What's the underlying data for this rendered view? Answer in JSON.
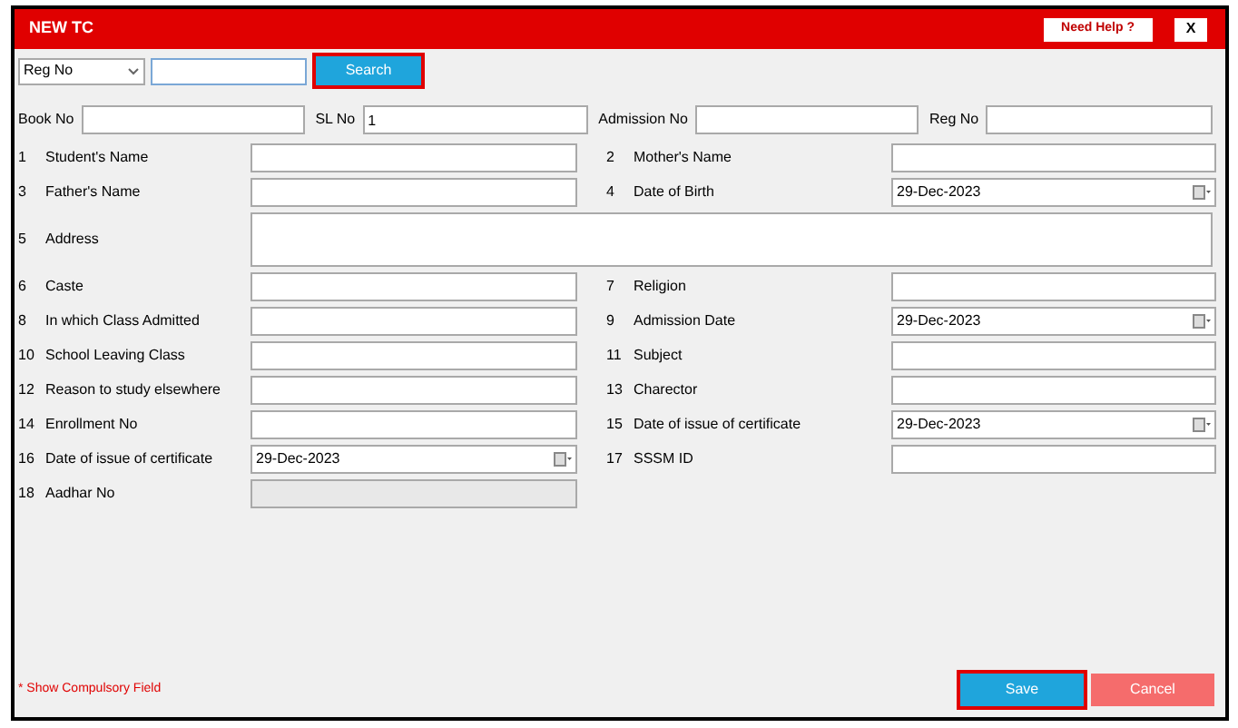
{
  "window": {
    "title": "NEW TC",
    "help_button": "Need Help ?",
    "close_button": "X"
  },
  "search_bar": {
    "select": "Reg No",
    "button": {
      "label": "Search",
      "highlighted": true
    }
  },
  "top_fields": [
    {
      "label": "Book No"
    },
    {
      "label": "SL No",
      "value": "1"
    },
    {
      "label": "Admission No"
    },
    {
      "label": "Reg No"
    }
  ],
  "rows": [
    {
      "fields": [
        {
          "number": "1",
          "label": "Student's Name",
          "kind": "text",
          "disabled": false
        },
        {
          "number": "2",
          "label": "Mother's Name",
          "kind": "text",
          "disabled": false
        }
      ]
    },
    {
      "fields": [
        {
          "number": "3",
          "label": "Father's Name",
          "kind": "text",
          "disabled": false
        },
        {
          "number": "4",
          "label": "Date of Birth",
          "kind": "date",
          "value": "29-Dec-2023"
        }
      ]
    },
    {
      "fields": [
        {
          "number": "5",
          "label": "Address",
          "kind": "area"
        }
      ]
    },
    {
      "fields": [
        {
          "number": "6",
          "label": "Caste",
          "kind": "text",
          "disabled": false
        },
        {
          "number": "7",
          "label": "Religion",
          "kind": "text",
          "disabled": false
        }
      ]
    },
    {
      "fields": [
        {
          "number": "8",
          "label": "In which Class Admitted",
          "kind": "text",
          "disabled": false
        },
        {
          "number": "9",
          "label": "Admission Date",
          "kind": "date",
          "value": "29-Dec-2023"
        }
      ]
    },
    {
      "fields": [
        {
          "number": "10",
          "label": "School Leaving Class",
          "kind": "text",
          "disabled": false
        },
        {
          "number": "11",
          "label": "Subject",
          "kind": "text",
          "disabled": false
        }
      ]
    },
    {
      "fields": [
        {
          "number": "12",
          "label": "Reason to study elsewhere",
          "kind": "text",
          "disabled": false
        },
        {
          "number": "13",
          "label": "Charector",
          "kind": "text",
          "disabled": false
        }
      ]
    },
    {
      "fields": [
        {
          "number": "14",
          "label": "Enrollment No",
          "kind": "text",
          "disabled": false
        },
        {
          "number": "15",
          "label": "Date of issue of certificate",
          "kind": "date",
          "value": "29-Dec-2023"
        }
      ]
    },
    {
      "fields": [
        {
          "number": "16",
          "label": "Date of issue of certificate",
          "kind": "date",
          "value": "29-Dec-2023"
        },
        {
          "number": "17",
          "label": "SSSM ID",
          "kind": "text",
          "disabled": false
        }
      ]
    },
    {
      "fields": [
        {
          "number": "18",
          "label": "Aadhar No",
          "kind": "text",
          "disabled": true
        }
      ]
    }
  ],
  "footer": {
    "note": "* Show Compulsory Field",
    "buttons": [
      {
        "label": "Save",
        "kind": "save",
        "highlighted": true
      },
      {
        "label": "Cancel",
        "kind": "cancel",
        "highlighted": false
      }
    ]
  }
}
